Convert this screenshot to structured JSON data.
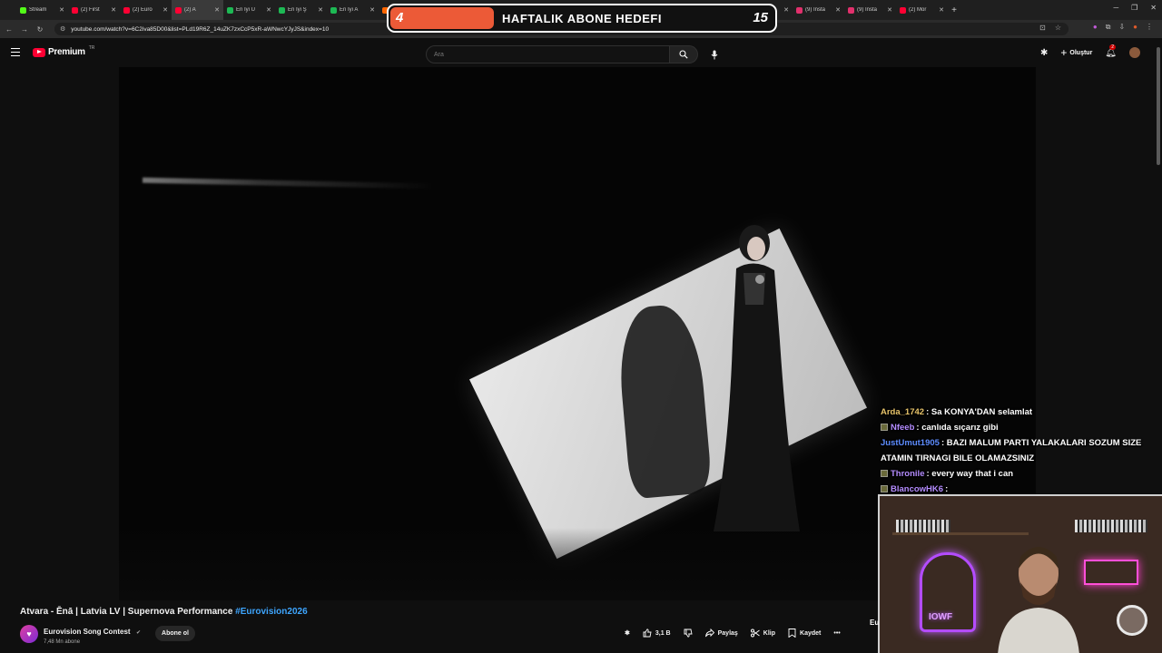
{
  "browser": {
    "tabs": [
      {
        "label": "Stream",
        "color": "#53fc18"
      },
      {
        "label": "(2) First",
        "color": "#ff0033"
      },
      {
        "label": "(2) Euro",
        "color": "#ff0033"
      },
      {
        "label": "(2) A",
        "color": "#ff0033",
        "active": true
      },
      {
        "label": "En İyi U",
        "color": "#1db954"
      },
      {
        "label": "En İyi Ş",
        "color": "#1db954"
      },
      {
        "label": "En İyi A",
        "color": "#1db954"
      },
      {
        "label": "Toddle",
        "color": "#ff6600"
      },
      {
        "label": "(2) Kar",
        "color": "#ff0033"
      },
      {
        "label": "(9) Insta",
        "color": "#e1306c"
      },
      {
        "label": "(9) Insta",
        "color": "#e1306c"
      },
      {
        "label": "(9) Insta",
        "color": "#e1306c"
      },
      {
        "label": "(9) Insta",
        "color": "#e1306c"
      },
      {
        "label": "(2) Güz",
        "color": "#ff0033"
      },
      {
        "label": "Güzel d",
        "color": "#ff0033"
      },
      {
        "label": "(9) Insta",
        "color": "#e1306c"
      },
      {
        "label": "(9) Insta",
        "color": "#e1306c"
      },
      {
        "label": "(2) Mor",
        "color": "#ff0033"
      }
    ],
    "url": "youtube.com/watch?v=6C2iva85D00&list=PLd19R6Z_14uZK7zxCcP5xR-aWNwcYJyJS&index=10"
  },
  "goal": {
    "current": "4",
    "label": "HAFTALIK ABONE HEDEFI",
    "target": "15",
    "fill_color": "#ec5a37"
  },
  "header": {
    "logo_text": "Premium",
    "logo_region": "TR",
    "search_placeholder": "Ara",
    "create_label": "Oluştur",
    "notifications_count": "2",
    "brand_color": "#ff0033"
  },
  "chat": {
    "messages": [
      {
        "user": "Arda_1742",
        "user_color": "#e8c46a",
        "text": ": Sa KONYA'DAN selamlat",
        "badge": false
      },
      {
        "user": "Nfeeb",
        "user_color": "#b48cff",
        "text": ": canlıda sıçarız gibi",
        "badge": true
      },
      {
        "user": "JustUmut1905",
        "user_color": "#5d8cff",
        "text": ": BAZI MALUM PARTI YALAKALARI SOZUM SIZE ATAMIN TIRNAGI BILE OLAMAZSINIZ",
        "badge": false
      },
      {
        "user": "Thronile",
        "user_color": "#b48cff",
        "text": ": every way that i can",
        "badge": true
      },
      {
        "user": "BlancowHK6",
        "user_color": "#b48cff",
        "text": ":",
        "badge": true
      }
    ]
  },
  "cam": {
    "neon_text": "IOWF"
  },
  "video": {
    "title_main": "Atvara - Ēnā | Latvia LV | Supernova Performance ",
    "title_hashtag": "#Eurovision2026",
    "channel_name": "Eurovision Song Contest",
    "subscribers": "7,48 Mn abone",
    "subscribe_label": "Abone ol",
    "likes": "3,1 B",
    "share_label": "Paylaş",
    "clip_label": "Klip",
    "save_label": "Kaydet",
    "next_peek": "Eu"
  }
}
